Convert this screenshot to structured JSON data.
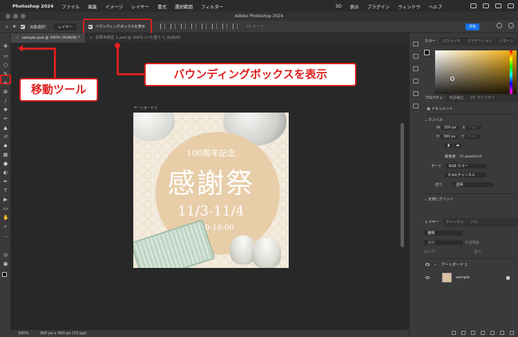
{
  "menubar": {
    "app": "Photoshop 2024",
    "items": [
      "ファイル",
      "編集",
      "イメージ",
      "レイヤー",
      "書式",
      "選択範囲",
      "フィルター",
      "3D",
      "表示",
      "プラグイン",
      "ウィンドウ",
      "ヘルプ"
    ]
  },
  "window": {
    "title": "Adobe Photoshop 2024"
  },
  "options": {
    "auto_select_label": "自動選択：",
    "auto_select_value": "レイヤー",
    "show_bbox_label": "バウンディングボックスを表示",
    "threed_mode": "3D モード：",
    "share_button": "共有"
  },
  "tabs": [
    {
      "label": "sample.psd @ 300% (RGB/8) *",
      "active": true
    },
    {
      "label": "名称未設定 1.psd @ 300% (べた塗り 1, RGB/8)",
      "active": false
    }
  ],
  "artboard": {
    "label": "アートボード 1",
    "line1": "100周年記念",
    "line2": "感謝祭",
    "line3": "11/3-11/4",
    "line4": "10:00-18:00"
  },
  "statusbar": {
    "zoom": "300%",
    "doc": "300 px x 300 px (72 ppi)"
  },
  "panels": {
    "color_tabs": [
      "カラー",
      "スウォッチ",
      "グラデーション",
      "パターン"
    ],
    "prop_tabs": [
      "プロパティ",
      "色調補正",
      "CC ライブラリ"
    ],
    "doc_label": "ドキュメント",
    "canvas_label": "カンバス",
    "w_label": "W",
    "w_value": "300 px",
    "h_label": "H",
    "h_value": "300 px",
    "x_label": "X",
    "x_value": "0 px",
    "y_label": "Y",
    "y_value": "0 px",
    "resolution": "解像度：72 pixel/inch",
    "mode_label": "モード",
    "mode_value": "RGB カラー",
    "bits_value": "8 bit/チャンネル",
    "fill_label": "塗り",
    "fill_value": "透明",
    "rulers_label": "定規とグリッド",
    "layer_tabs": [
      "レイヤー",
      "チャンネル",
      "パス"
    ],
    "layer_kind": "種類",
    "blend": "通常",
    "opacity": "不透明度",
    "lock_label": "ロック：",
    "fill2": "塗り",
    "layers": [
      {
        "name": "アートボード 1"
      },
      {
        "name": "sample"
      }
    ]
  },
  "callouts": {
    "move_tool": "移動ツール",
    "bbox": "バウンディングボックスを表示"
  },
  "colors": {
    "accent_red": "#e01e1e",
    "share_blue": "#1473e6"
  }
}
